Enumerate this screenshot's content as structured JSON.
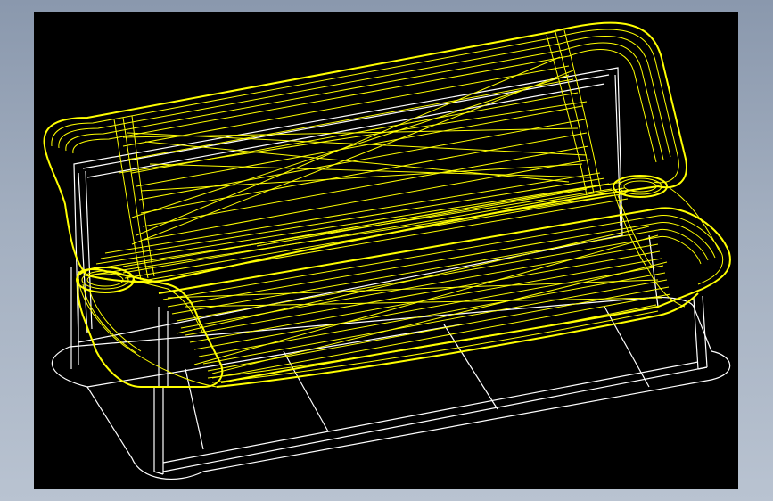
{
  "background": {
    "gradient_top": "#8a98ad",
    "gradient_bottom": "#b9c3d1"
  },
  "viewport": {
    "background": "#000000"
  },
  "model": {
    "subject": "sofa",
    "render_mode": "wireframe",
    "cushion_color": "#ffff00",
    "frame_color": "#ffffff"
  }
}
